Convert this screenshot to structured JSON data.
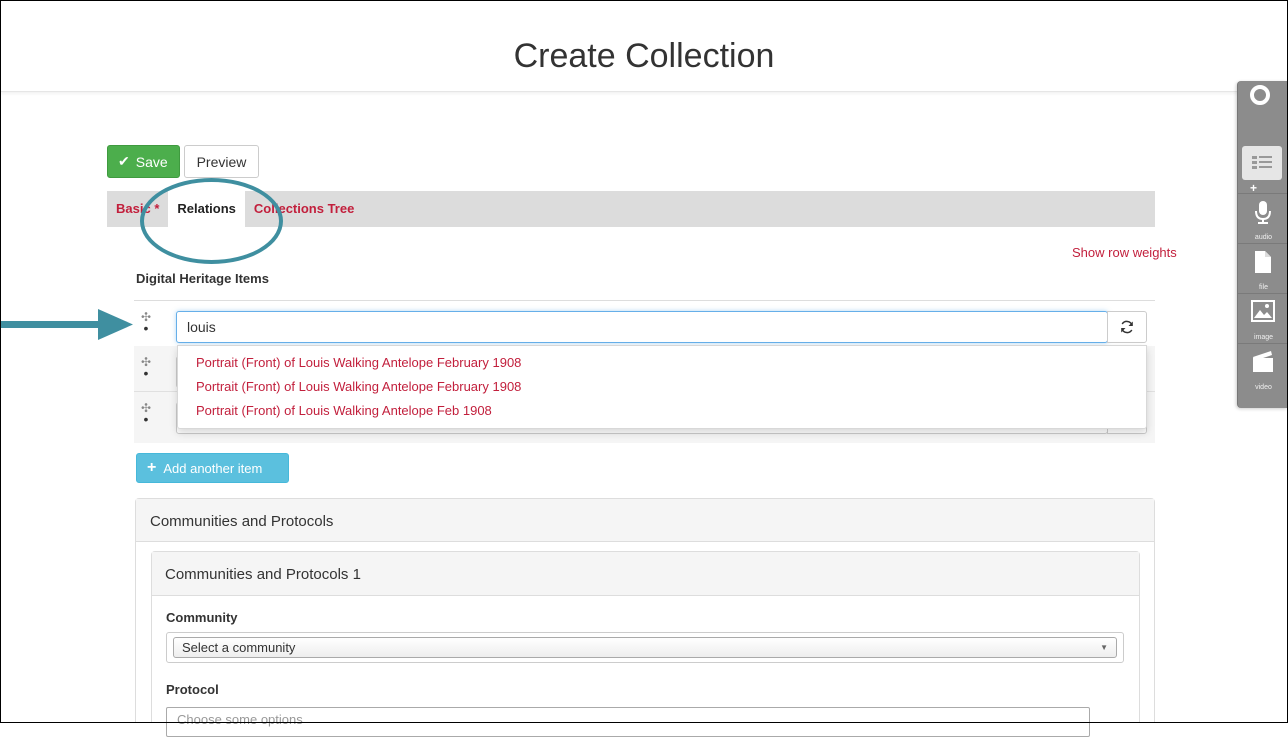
{
  "page": {
    "title": "Create Collection"
  },
  "actions": {
    "save_label": "Save",
    "preview_label": "Preview"
  },
  "tabs": [
    {
      "label": "Basic",
      "required": "*"
    },
    {
      "label": "Relations"
    },
    {
      "label": "Collections Tree"
    }
  ],
  "relations": {
    "show_row_weights": "Show row weights",
    "section_title": "Digital Heritage Items",
    "search_value": "louis",
    "suggestions": [
      "Portrait (Front) of Louis Walking Antelope February 1908",
      "Portrait (Front) of Louis Walking Antelope February 1908",
      "Portrait (Front) of Louis Walking Antelope Feb 1908"
    ],
    "add_label": "Add another item"
  },
  "communities": {
    "panel_title": "Communities and Protocols",
    "subpanel_title": "Communities and Protocols 1",
    "community_label": "Community",
    "community_select": "Select a community",
    "protocol_label": "Protocol",
    "protocol_placeholder": "Choose some options"
  },
  "sidebar": {
    "items": [
      {
        "label": "audio",
        "icon": "microphone-icon"
      },
      {
        "label": "file",
        "icon": "file-icon"
      },
      {
        "label": "image",
        "icon": "image-icon"
      },
      {
        "label": "video",
        "icon": "clapperboard-icon"
      }
    ]
  },
  "colors": {
    "link_red": "#c21f3c",
    "save_green": "#4cae4c",
    "add_blue": "#5bc0de",
    "callout_teal": "#3f8fa0"
  }
}
